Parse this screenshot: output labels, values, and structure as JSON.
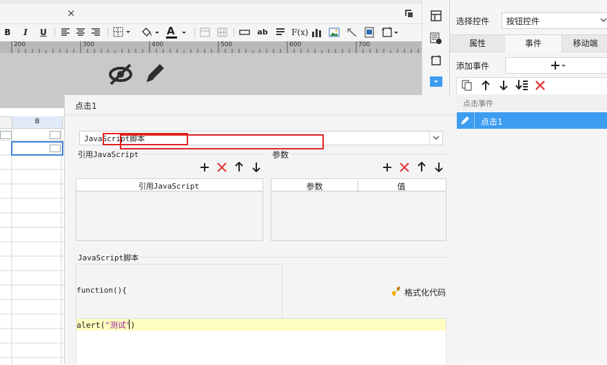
{
  "tabbar": {
    "close_glyph": "×"
  },
  "toolbar": {
    "bold": "B",
    "italic": "I",
    "underline": "U",
    "text_ab": "ab",
    "fx": "F(x)",
    "font_color_letter": "A"
  },
  "ruler": {
    "ticks": [
      "200",
      "300",
      "400",
      "500",
      "600",
      "700"
    ]
  },
  "sheet": {
    "column_b": "B"
  },
  "right_panel": {
    "select_control_label": "选择控件",
    "select_control_value": "按钮控件",
    "tabs": [
      "属性",
      "事件",
      "移动端"
    ],
    "add_event_label": "添加事件",
    "events_header": "点击事件",
    "events": [
      "点击1"
    ]
  },
  "dialog": {
    "title": "点击1",
    "type_select": "JavaScript脚本",
    "ref_js_label": "引用JavaScript",
    "params_label": "参数",
    "ref_js_col": "引用JavaScript",
    "param_col": "参数",
    "value_col": "值",
    "script_label": "JavaScript脚本",
    "func_header": "function(){",
    "code_prefix": "alert(",
    "code_string": "\"测试\"",
    "code_suffix": ")",
    "format_code": "格式化代码"
  },
  "colors": {
    "accent_blue": "#3d9df0",
    "highlight_red": "#e02020",
    "code_yellow": "#fffdc0",
    "string_purple": "#9a2a9a"
  }
}
